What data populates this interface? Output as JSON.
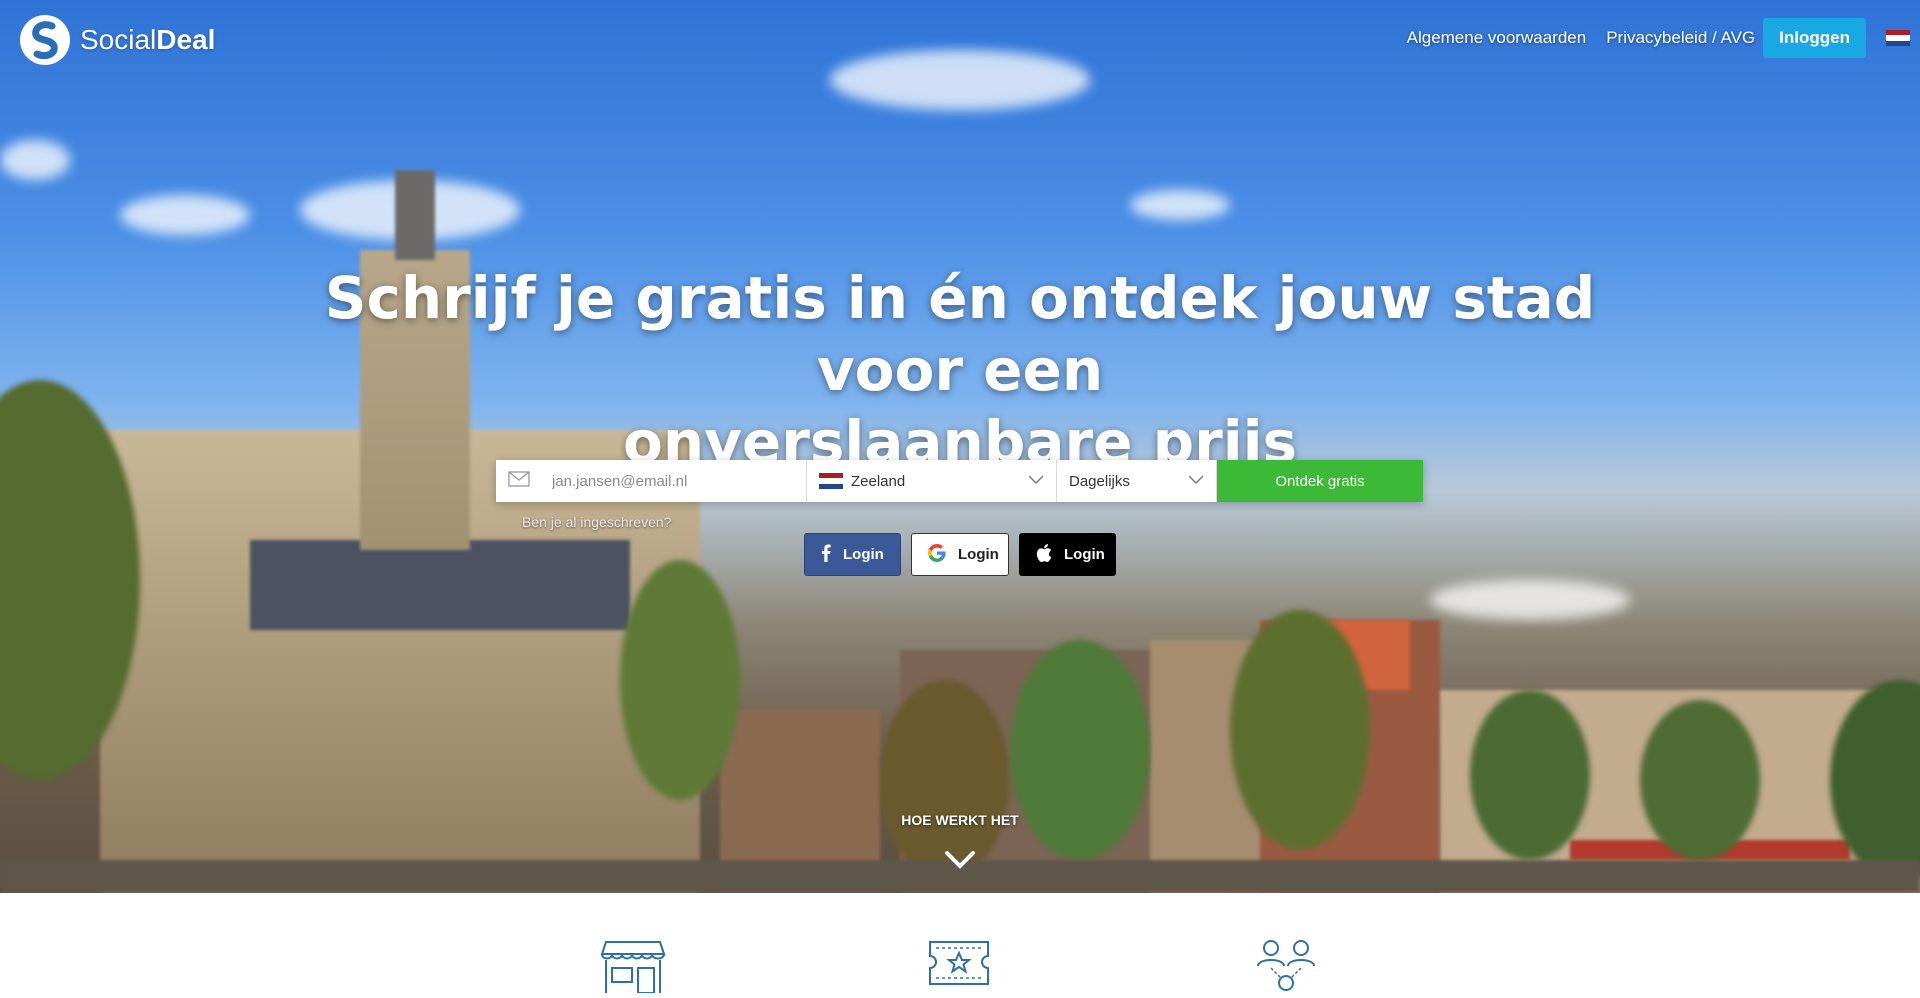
{
  "brand": {
    "name_light": "Social",
    "name_bold": "Deal"
  },
  "nav": {
    "terms": "Algemene voorwaarden",
    "privacy": "Privacybeleid / AVG",
    "login": "Inloggen",
    "language_flag": "netherlands-flag-icon"
  },
  "hero": {
    "headline_line1": "Schrijf je gratis in én ontdek jouw stad voor een",
    "headline_line2": "onverslaanbare prijs"
  },
  "signup": {
    "email_placeholder": "jan.jansen@email.nl",
    "region": "Zeeland",
    "frequency": "Dagelijks",
    "submit": "Ontdek gratis",
    "already_registered": "Ben je al ingeschreven?"
  },
  "social_login": {
    "facebook": "Login",
    "google": "Login",
    "apple": "Login"
  },
  "how_it_works": "HOE WERKT HET",
  "colors": {
    "login_blue": "#18a9e4",
    "cta_green": "#3cba37",
    "facebook_blue": "#3b5998",
    "icon_blue": "#2f6fa8"
  }
}
